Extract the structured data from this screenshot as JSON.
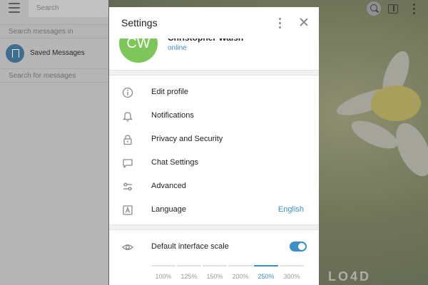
{
  "background": {
    "search_placeholder": "Search",
    "search_messages_in": "Search messages in",
    "saved_messages": "Saved Messages",
    "search_for_messages": "Search for messages",
    "watermark": "LO4D"
  },
  "settings": {
    "title": "Settings",
    "profile": {
      "initials": "CW",
      "name": "Christopher Walsh",
      "status": "online"
    },
    "menu": [
      {
        "label": "Edit profile",
        "icon": "info-icon"
      },
      {
        "label": "Notifications",
        "icon": "bell-icon"
      },
      {
        "label": "Privacy and Security",
        "icon": "lock-icon"
      },
      {
        "label": "Chat Settings",
        "icon": "chat-bubble-icon"
      },
      {
        "label": "Advanced",
        "icon": "sliders-icon"
      },
      {
        "label": "Language",
        "icon": "language-icon",
        "value": "English"
      }
    ],
    "scale": {
      "label": "Default interface scale",
      "enabled": true,
      "options": [
        "100%",
        "125%",
        "150%",
        "200%",
        "250%",
        "300%"
      ],
      "selected": "250%"
    }
  },
  "colors": {
    "accent": "#3d8fc6",
    "avatar_bg": "#7dc75a"
  }
}
